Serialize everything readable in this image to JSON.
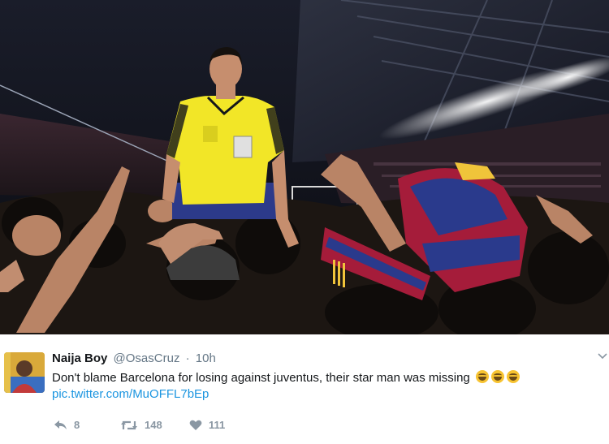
{
  "photo": {
    "alt_subject": "referee-among-crowd"
  },
  "tweet": {
    "author_name": "Naija Boy",
    "author_handle": "@OsasCruz",
    "separator": "·",
    "timestamp": "10h",
    "text": "Don't blame Barcelona for losing against juventus, their star man was missing",
    "emoji_count": 3,
    "link": "pic.twitter.com/MuOFFL7bEp",
    "actions": {
      "reply_count": "8",
      "retweet_count": "148",
      "like_count": "111"
    }
  },
  "colors": {
    "link": "#1b95e0",
    "secondary_text": "#657786",
    "action_gray": "#8a97a3",
    "referee_shirt": "#f2e627"
  },
  "icons": [
    "reply-icon",
    "retweet-icon",
    "like-icon",
    "caret-down-icon",
    "avatar"
  ]
}
